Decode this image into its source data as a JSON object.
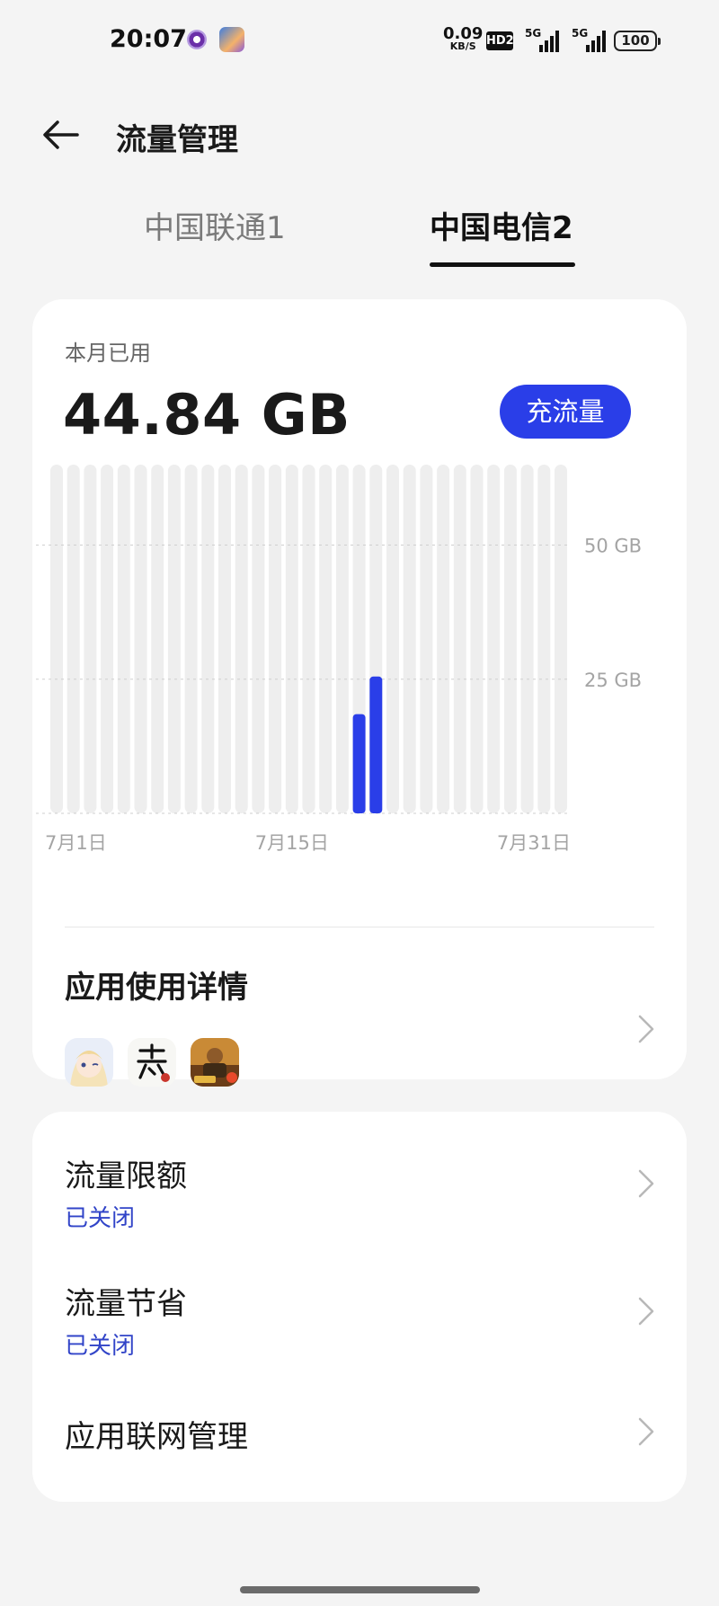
{
  "status_bar": {
    "time": "20:07",
    "net_speed_value": "0.09",
    "net_speed_unit": "KB/S",
    "hd_badge": "HD2",
    "sim1_label": "5G",
    "sim2_label": "5G",
    "battery": "100",
    "icons": [
      "notification-app-icon",
      "game-app-icon",
      "hd-voice-icon",
      "signal-icon",
      "signal-icon",
      "battery-icon"
    ]
  },
  "header": {
    "title": "流量管理",
    "back_icon": "arrow-left-icon"
  },
  "tabs": [
    {
      "label": "中国联通1",
      "active": false
    },
    {
      "label": "中国电信2",
      "active": true
    }
  ],
  "usage": {
    "label": "本月已用",
    "value": "44.84 GB",
    "recharge_button": "充流量"
  },
  "chart_data": {
    "type": "bar",
    "x": [
      "7月1日",
      "7月2日",
      "7月3日",
      "7月4日",
      "7月5日",
      "7月6日",
      "7月7日",
      "7月8日",
      "7月9日",
      "7月10日",
      "7月11日",
      "7月12日",
      "7月13日",
      "7月14日",
      "7月15日",
      "7月16日",
      "7月17日",
      "7月18日",
      "7月19日",
      "7月20日",
      "7月21日",
      "7月22日",
      "7月23日",
      "7月24日",
      "7月25日",
      "7月26日",
      "7月27日",
      "7月28日",
      "7月29日",
      "7月30日",
      "7月31日"
    ],
    "values": [
      0,
      0,
      0,
      0,
      0,
      0,
      0,
      0,
      0,
      0,
      0,
      0,
      0,
      0,
      0,
      0,
      0,
      0,
      18.5,
      25.5,
      0,
      0,
      0,
      0,
      0,
      0,
      0,
      0,
      0,
      0,
      0
    ],
    "unit": "GB",
    "ylim": [
      0,
      65
    ],
    "gridlines": [
      {
        "value": 50,
        "label": "50 GB"
      },
      {
        "value": 25,
        "label": "25 GB"
      },
      {
        "value": 0,
        "label": ""
      }
    ],
    "xtick_labels": [
      "7月1日",
      "7月15日",
      "7月31日"
    ],
    "bar_color": "#2a3ee8",
    "track_color": "#eeeeee"
  },
  "app_usage": {
    "title": "应用使用详情",
    "app_icons": [
      "genshin-app-icon",
      "ni-shui-han-app-icon",
      "peace-elite-app-icon"
    ],
    "chevron": "chevron-right-icon"
  },
  "settings": [
    {
      "title": "流量限额",
      "status": "已关闭"
    },
    {
      "title": "流量节省",
      "status": "已关闭"
    },
    {
      "title": "应用联网管理",
      "status": ""
    }
  ],
  "colors": {
    "accent": "#2a3ee8",
    "status_text": "#3144c8",
    "background": "#f4f4f4",
    "card": "#ffffff"
  }
}
